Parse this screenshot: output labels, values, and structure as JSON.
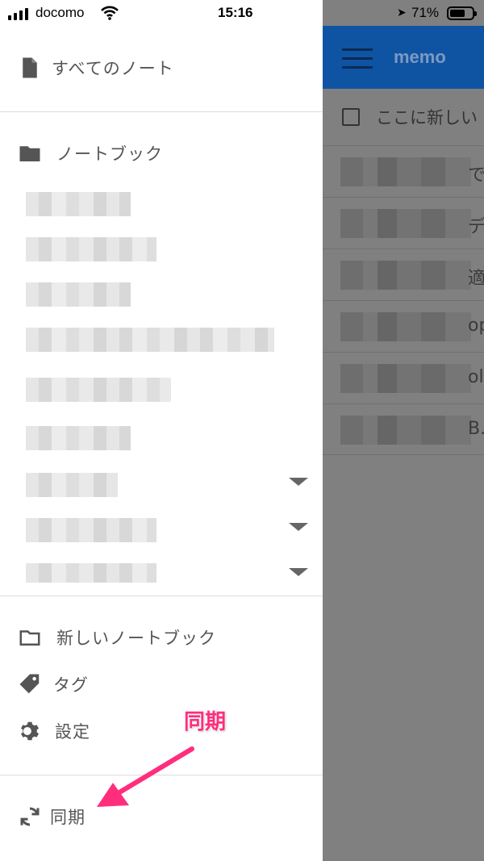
{
  "status_bar": {
    "carrier": "docomo",
    "time": "15:16",
    "battery_percent": "71%",
    "battery_level": 0.71
  },
  "background_app": {
    "title": "memo",
    "new_todo_placeholder": "ここに新しい",
    "note_tails": [
      "で、",
      "ディ",
      "適用",
      "op",
      "oli",
      "B."
    ]
  },
  "menu": {
    "all_notes": "すべてのノート",
    "notebooks_header": "ノートブック",
    "new_notebook": "新しいノートブック",
    "tags": "タグ",
    "settings": "設定",
    "sync": "同期"
  },
  "annotation": {
    "label": "同期",
    "color": "#ff2e7d"
  },
  "colors": {
    "header_blue": "#0f54a3",
    "overlay_gray": "#808080",
    "menu_text": "#555555"
  }
}
